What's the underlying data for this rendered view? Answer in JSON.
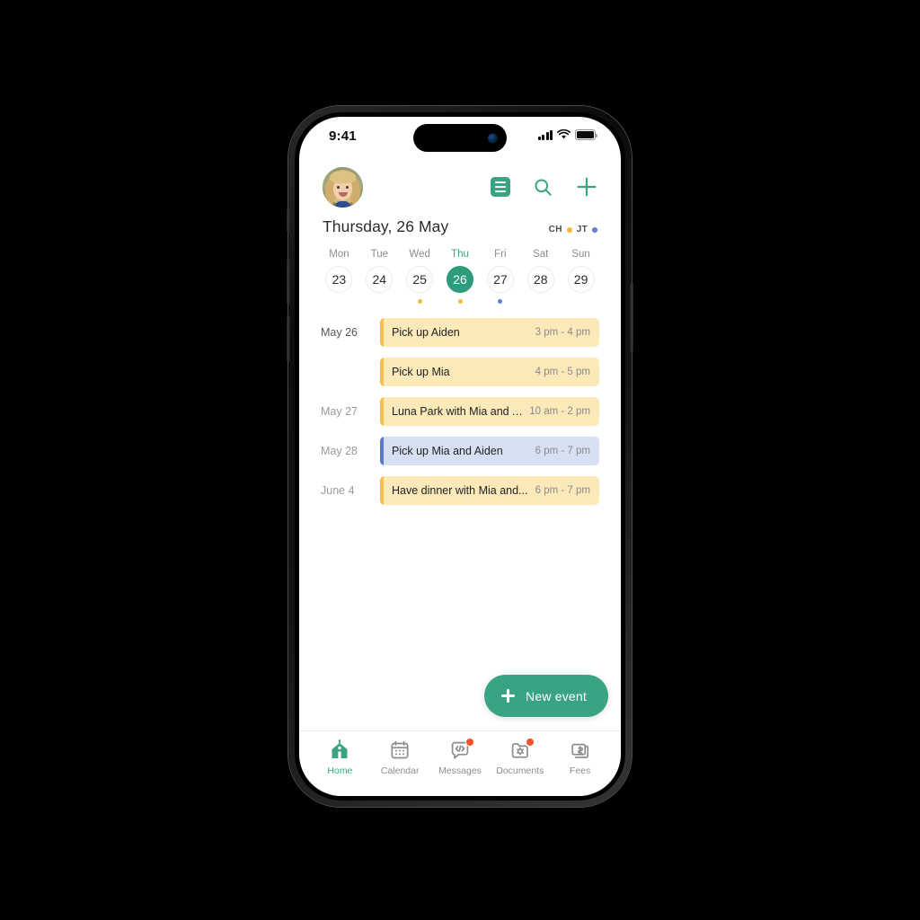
{
  "status_bar": {
    "time": "9:41",
    "signal_icon": "cellular-bars-icon",
    "wifi_icon": "wifi-icon",
    "battery_icon": "battery-full-icon"
  },
  "header": {
    "avatar_name": "user-avatar",
    "actions": [
      {
        "name": "list-view-button",
        "icon": "list-icon"
      },
      {
        "name": "search-button",
        "icon": "search-icon"
      },
      {
        "name": "add-button",
        "icon": "plus-icon"
      }
    ]
  },
  "date_header": {
    "title": "Thursday, 26 May",
    "people": [
      {
        "initials": "CH",
        "color": "#f2b93c"
      },
      {
        "initials": "JT",
        "color": "#5b7fd4"
      }
    ]
  },
  "week_strip": {
    "days": [
      {
        "name": "Mon",
        "number": "23",
        "active": false,
        "dot": null
      },
      {
        "name": "Tue",
        "number": "24",
        "active": false,
        "dot": null
      },
      {
        "name": "Wed",
        "number": "25",
        "active": false,
        "dot": "#f2b93c"
      },
      {
        "name": "Thu",
        "number": "26",
        "active": true,
        "dot": "#f2b93c"
      },
      {
        "name": "Fri",
        "number": "27",
        "active": false,
        "dot": "#5b7fd4"
      },
      {
        "name": "Sat",
        "number": "28",
        "active": false,
        "dot": null
      },
      {
        "name": "Sun",
        "number": "29",
        "active": false,
        "dot": null
      }
    ],
    "selected_color": "#2f9b7d"
  },
  "events": [
    {
      "date": "May 26",
      "date_muted": false,
      "title": "Pick up Aiden",
      "time": "3 pm - 4 pm",
      "color": "yellow"
    },
    {
      "date": "",
      "date_muted": false,
      "title": "Pick up Mia",
      "time": "4 pm - 5 pm",
      "color": "yellow"
    },
    {
      "date": "May 27",
      "date_muted": true,
      "title": "Luna Park with Mia and Ai...",
      "time": "10 am - 2 pm",
      "color": "yellow"
    },
    {
      "date": "May 28",
      "date_muted": true,
      "title": "Pick up Mia and Aiden",
      "time": "6 pm - 7 pm",
      "color": "blue"
    },
    {
      "date": "June 4",
      "date_muted": true,
      "title": "Have dinner with Mia and...",
      "time": "6 pm - 7 pm",
      "color": "yellow"
    }
  ],
  "fab": {
    "label": "New event",
    "icon": "plus-icon",
    "color": "#3aa384"
  },
  "bottom_nav": {
    "items": [
      {
        "label": "Home",
        "icon": "home-icon",
        "active": true,
        "badge": false
      },
      {
        "label": "Calendar",
        "icon": "calendar-icon",
        "active": false,
        "badge": false
      },
      {
        "label": "Messages",
        "icon": "message-code-icon",
        "active": false,
        "badge": true
      },
      {
        "label": "Documents",
        "icon": "folder-settings-icon",
        "active": false,
        "badge": true
      },
      {
        "label": "Fees",
        "icon": "money-stack-icon",
        "active": false,
        "badge": false
      }
    ],
    "active_color": "#3aa384",
    "badge_color": "#f4502a"
  }
}
